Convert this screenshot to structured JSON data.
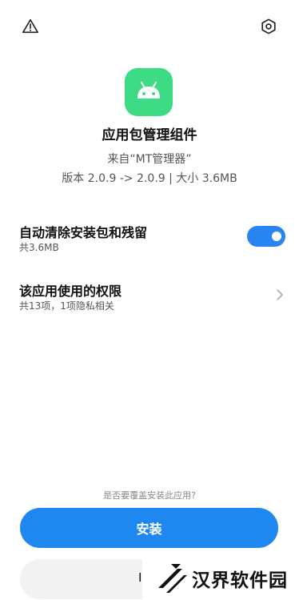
{
  "header": {
    "warning_icon": "warning-icon",
    "settings_icon": "settings-hexagon-icon"
  },
  "app": {
    "name": "应用包管理组件",
    "source": "来自“MT管理器”",
    "version_size": "版本 2.0.9 -> 2.0.9 | 大小 3.6MB",
    "icon_color": "#3ddc84"
  },
  "options": {
    "clean": {
      "title": "自动清除安装包和残留",
      "subtitle": "共3.6MB",
      "toggle_on": true
    },
    "permissions": {
      "title": "该应用使用的权限",
      "subtitle": "共13项，1项隐私相关"
    }
  },
  "footer": {
    "question": "是否要覆盖安装此应用?",
    "install_label": "安装",
    "cancel_label_partial": "I"
  },
  "watermark": {
    "text": "汉界软件园"
  },
  "colors": {
    "accent": "#1f87f0",
    "toggle": "#2784f0",
    "android_green": "#3ddc84"
  }
}
